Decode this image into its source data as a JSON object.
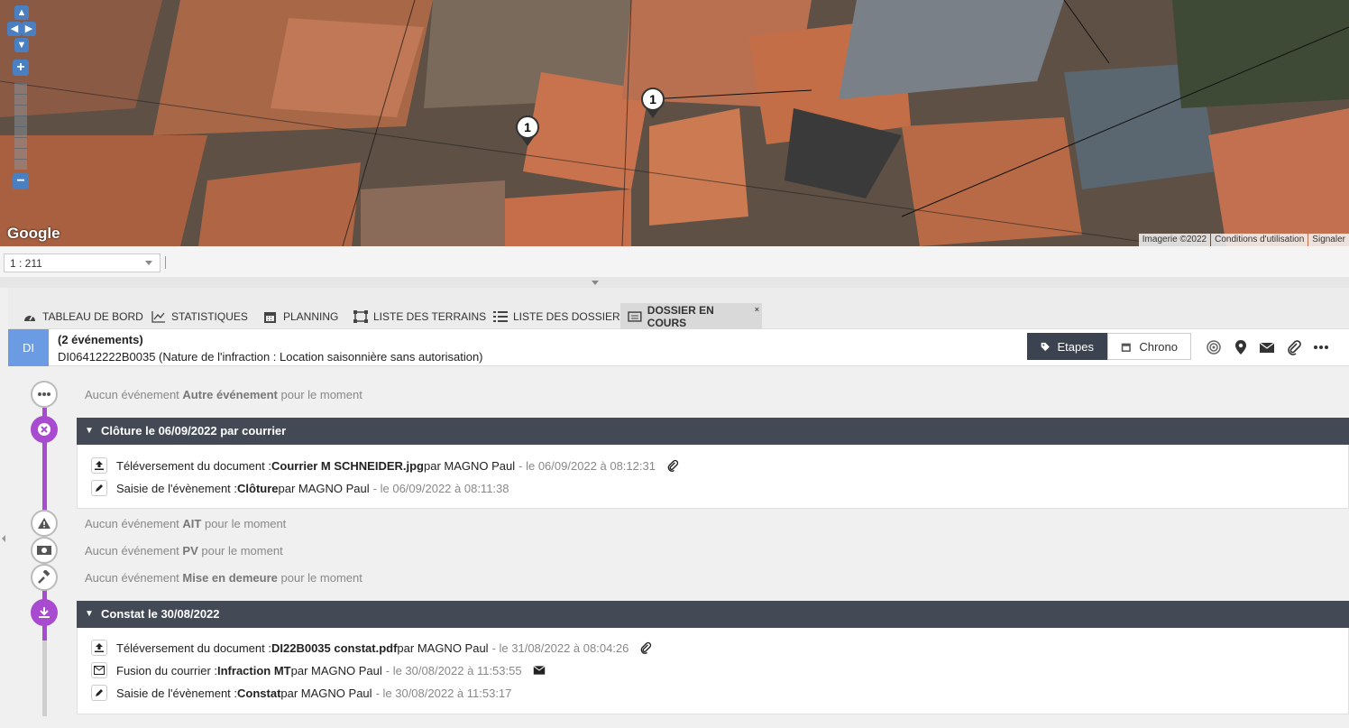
{
  "map": {
    "pins": [
      {
        "label": "1"
      },
      {
        "label": "1"
      }
    ],
    "google_logo": "Google",
    "footer": [
      "Imagerie ©2022",
      "Conditions d'utilisation",
      "Signaler"
    ],
    "zoom_in": "+",
    "zoom_out": "−"
  },
  "scale": {
    "value": "1 : 211"
  },
  "tabs": [
    {
      "label": "TABLEAU DE BORD",
      "icon": "dashboard-icon"
    },
    {
      "label": "STATISTIQUES",
      "icon": "chart-line-icon"
    },
    {
      "label": "PLANNING",
      "icon": "calendar-icon"
    },
    {
      "label": "LISTE DES TERRAINS",
      "icon": "terrain-icon"
    },
    {
      "label": "LISTE DES DOSSIERS",
      "icon": "list-icon"
    },
    {
      "label": "DOSSIER EN COURS",
      "icon": "folder-icon",
      "active": true,
      "close": "×"
    }
  ],
  "dossier": {
    "badge": "DI",
    "count": "(2 événements)",
    "reference": "DI06412222B0035",
    "nature": " (Nature de l'infraction : Location saisonnière sans autorisation)",
    "toggle_etapes": "Etapes",
    "toggle_chrono": "Chrono"
  },
  "timeline": {
    "empty_prefix": "Aucun événement ",
    "empty_suffix": " pour le moment",
    "empty_autre": "Autre événement",
    "empty_ait": "AIT",
    "empty_pv": "PV",
    "empty_mise": "Mise en demeure",
    "cloture_header": "Clôture le 06/09/2022 par courrier",
    "constat_header": "Constat le 30/08/2022",
    "cloture_events": [
      {
        "prefix": "Téléversement du document : ",
        "bold": "Courrier M SCHNEIDER.jpg",
        "by": " par MAGNO Paul",
        "date": "- le 06/09/2022 à 08:12:31"
      },
      {
        "prefix": "Saisie de l'évènement : ",
        "bold": "Clôture",
        "by": " par MAGNO Paul",
        "date": "- le 06/09/2022 à 08:11:38"
      }
    ],
    "constat_events": [
      {
        "prefix": "Téléversement du document : ",
        "bold": "DI22B0035 constat.pdf",
        "by": " par MAGNO Paul",
        "date": "- le 31/08/2022 à 08:04:26"
      },
      {
        "prefix": "Fusion du courrier : ",
        "bold": "Infraction MT",
        "by": " par MAGNO Paul",
        "date": "- le 30/08/2022 à 11:53:55"
      },
      {
        "prefix": "Saisie de l'évènement : ",
        "bold": "Constat",
        "by": " par MAGNO Paul",
        "date": "- le 30/08/2022 à 11:53:17"
      }
    ]
  },
  "colors": {
    "accent_purple": "#a84bd0",
    "header_dark": "#434a55",
    "badge_blue": "#6a9be3"
  }
}
